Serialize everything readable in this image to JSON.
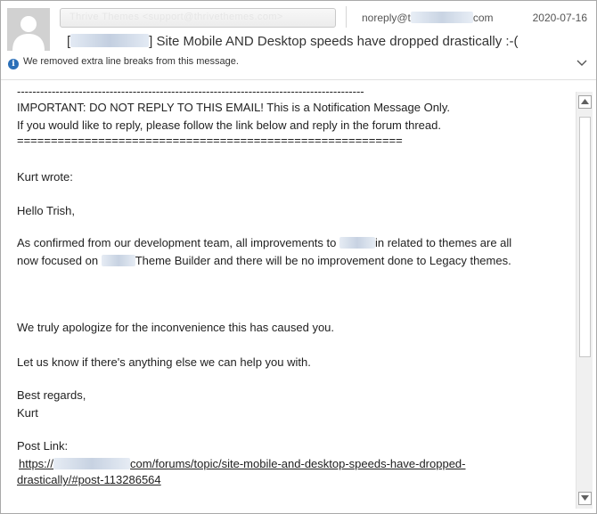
{
  "header": {
    "sender_name": "Thrive Themes <support@thrivethemes.com>",
    "from_prefix": "noreply@t",
    "from_suffix": "com",
    "date": "2020-07-16",
    "subject_open": "[",
    "subject_rest": "] Site Mobile AND Desktop speeds have dropped drastically :-(",
    "info_text": "We removed extra line breaks from this message."
  },
  "body": {
    "sep1": "------------------------------------------------------------------------------------------",
    "important": "IMPORTANT: DO NOT REPLY TO THIS EMAIL! This is a Notification Message Only.",
    "reply_hint": " If you would like to reply, please follow the link below and reply in the  forum thread.",
    "sep2": "=========================================================",
    "wrote": "Kurt wrote:",
    "greeting": "Hello Trish,",
    "p1_a": "As confirmed from our development team, all improvements to ",
    "p1_b": "in  related to themes are all",
    "p2_a": "now focused on ",
    "p2_b": "Theme Builder and there will be no  improvement done to Legacy themes.",
    "apology": "We truly apologize for the inconvenience this has caused you.",
    "help": "Let us know if there's anything else we can help you with.",
    "regards": "Best regards,",
    "signature": "Kurt",
    "post_link_label": "Post Link:",
    "link_prefix": "https://",
    "link_rest": "com/forums/topic/site-mobile-and-desktop-speeds-have-dropped-",
    "link_line2": "drastically/#post-113286564"
  }
}
